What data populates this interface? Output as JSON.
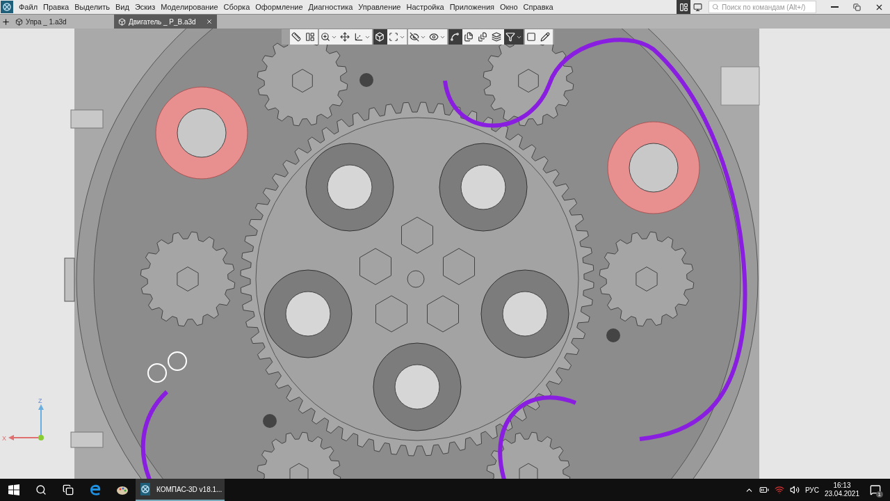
{
  "menu": {
    "items": [
      "Файл",
      "Правка",
      "Выделить",
      "Вид",
      "Эскиз",
      "Моделирование",
      "Сборка",
      "Оформление",
      "Диагностика",
      "Управление",
      "Настройка",
      "Приложения",
      "Окно",
      "Справка"
    ]
  },
  "title_bar": {
    "panel_buttons": [
      {
        "selected": true
      },
      {
        "selected": false
      }
    ],
    "search": {
      "placeholder": "Поиск по командам (Alt+/)"
    }
  },
  "tabs": [
    {
      "label": "Упра _ 1.a3d",
      "selected": false
    },
    {
      "label": "Двигатель _ Р_В.a3d",
      "selected": true
    }
  ],
  "toolbar": {
    "groups": [
      [
        {
          "selected": false,
          "dropdown": false
        },
        {
          "selected": false,
          "dropdown": false
        }
      ],
      [
        {
          "selected": false,
          "dropdown": true
        },
        {
          "selected": false,
          "dropdown": false
        },
        {
          "selected": false,
          "dropdown": true
        }
      ],
      [
        {
          "selected": true,
          "dropdown": false
        },
        {
          "selected": false,
          "dropdown": true
        }
      ],
      [
        {
          "selected": false,
          "dropdown": true
        },
        {
          "selected": false,
          "dropdown": true
        }
      ],
      [
        {
          "selected": true,
          "dropdown": false
        },
        {
          "selected": false,
          "dropdown": false
        },
        {
          "selected": false,
          "dropdown": false
        },
        {
          "selected": false,
          "dropdown": false
        },
        {
          "selected": true,
          "dropdown": true
        }
      ],
      [
        {
          "selected": false,
          "dropdown": false
        },
        {
          "selected": false,
          "dropdown": false
        }
      ]
    ]
  },
  "axes": {
    "z": "Z",
    "x": "X"
  },
  "taskbar": {
    "app": {
      "label": "КОМПАС-3D v18.1...",
      "selected": true
    },
    "language": "РУС",
    "time": "16:13",
    "date": "23.04.2021",
    "notifications": "1"
  }
}
